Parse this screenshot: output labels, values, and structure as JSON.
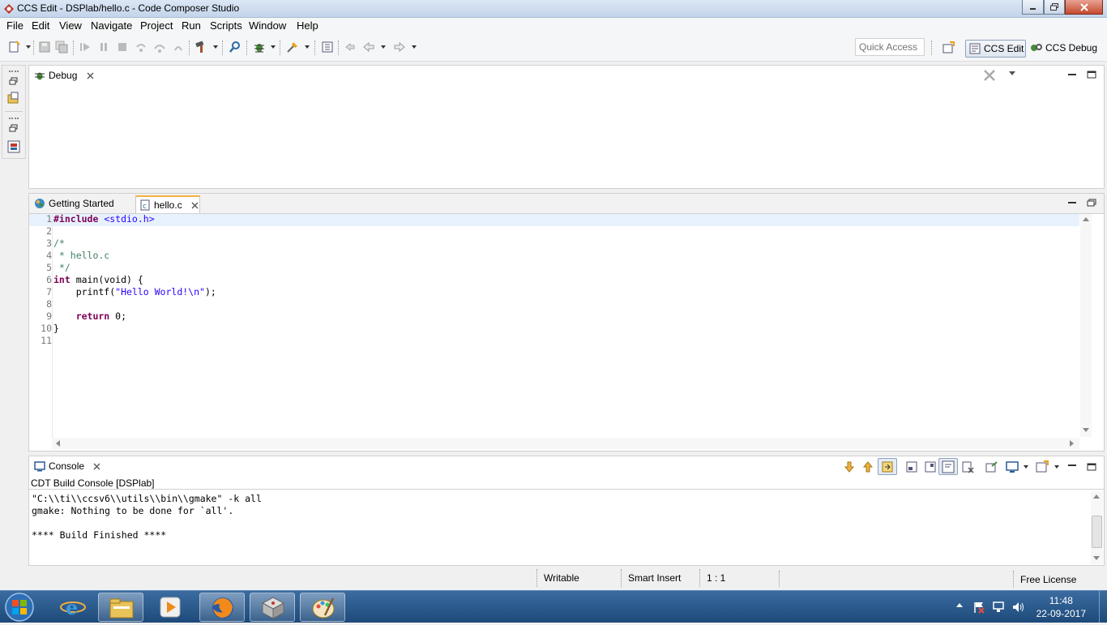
{
  "window": {
    "title": "CCS Edit - DSPlab/hello.c - Code Composer Studio"
  },
  "menu": [
    "File",
    "Edit",
    "View",
    "Navigate",
    "Project",
    "Run",
    "Scripts",
    "Window",
    "Help"
  ],
  "quick_access": {
    "placeholder": "Quick Access"
  },
  "perspectives": {
    "edit": "CCS Edit",
    "debug": "CCS Debug"
  },
  "debug_view": {
    "tab": "Debug"
  },
  "editor": {
    "tabs": [
      {
        "label": "Getting Started"
      },
      {
        "label": "hello.c"
      }
    ],
    "line_numbers": "1\n2\n3\n4\n5\n6\n7\n8\n9\n10\n11",
    "lines": [
      "#include <stdio.h>",
      "",
      "/*",
      " * hello.c",
      " */",
      "int main(void) {",
      "    printf(\"Hello World!\\n\");",
      "",
      "    return 0;",
      "}",
      ""
    ]
  },
  "console": {
    "tab": "Console",
    "subtitle": "CDT Build Console [DSPlab]",
    "lines": [
      "\"C:\\\\ti\\\\ccsv6\\\\utils\\\\bin\\\\gmake\" -k all",
      "gmake: Nothing to be done for `all'.",
      "",
      "**** Build Finished ****"
    ]
  },
  "status": {
    "writable": "Writable",
    "insert_mode": "Smart Insert",
    "position": "1 : 1",
    "license": "Free License"
  },
  "taskbar": {
    "time": "11:48",
    "date": "22-09-2017"
  }
}
